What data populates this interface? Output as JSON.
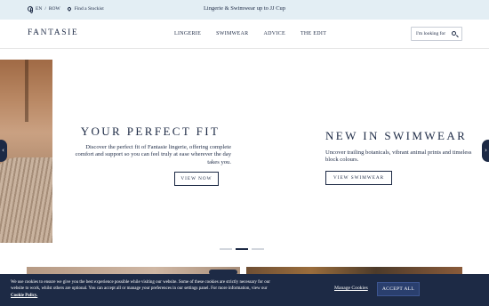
{
  "topbar": {
    "lang": "EN",
    "separator": "/",
    "region": "ROW",
    "stockist": "Find a Stockist",
    "promo": "Lingerie & Swimwear up to JJ Cup"
  },
  "header": {
    "logo": "FANTASIE",
    "nav": [
      "LINGERIE",
      "SWIMWEAR",
      "ADVICE",
      "THE EDIT"
    ],
    "search_placeholder": "I'm looking for"
  },
  "hero": {
    "slides": [
      {
        "title": "YOUR PERFECT FIT",
        "body": "Discover the perfect fit of Fantasie lingerie, offering complete comfort and support so you can feel truly at ease wherever the day takes you.",
        "cta": "VIEW NOW"
      },
      {
        "title": "NEW IN SWIMWEAR",
        "body": "Uncover trailing botanicals, vibrant animal prints and timeless block colours.",
        "cta": "VIEW SWIMWEAR"
      }
    ],
    "arrows": {
      "prev": "‹",
      "next": "›"
    },
    "dots": {
      "count": 3,
      "active": 2
    }
  },
  "cookie": {
    "text": "We use cookies to ensure we give you the best experience possible while visiting our website. Some of these cookies are strictly necessary for our website to work, whilst others are optional. You can accept all or manage your preferences in our settings panel. For more information, view our",
    "link": "Cookie Policy.",
    "manage": "Manage Cookies",
    "accept": "ACCEPT ALL"
  },
  "colors": {
    "navy": "#1d2a45",
    "topbar_bg": "#e3eef4",
    "accept_bg": "#2a3f6e"
  }
}
